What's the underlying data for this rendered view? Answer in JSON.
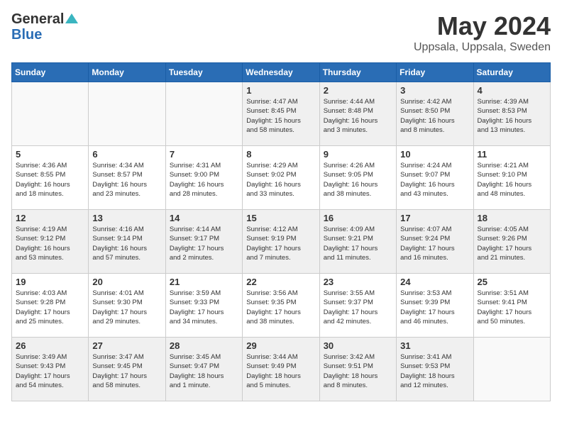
{
  "header": {
    "logo_general": "General",
    "logo_blue": "Blue",
    "month_title": "May 2024",
    "location": "Uppsala, Uppsala, Sweden"
  },
  "days_of_week": [
    "Sunday",
    "Monday",
    "Tuesday",
    "Wednesday",
    "Thursday",
    "Friday",
    "Saturday"
  ],
  "weeks": [
    [
      {
        "day": "",
        "info": ""
      },
      {
        "day": "",
        "info": ""
      },
      {
        "day": "",
        "info": ""
      },
      {
        "day": "1",
        "info": "Sunrise: 4:47 AM\nSunset: 8:45 PM\nDaylight: 15 hours\nand 58 minutes."
      },
      {
        "day": "2",
        "info": "Sunrise: 4:44 AM\nSunset: 8:48 PM\nDaylight: 16 hours\nand 3 minutes."
      },
      {
        "day": "3",
        "info": "Sunrise: 4:42 AM\nSunset: 8:50 PM\nDaylight: 16 hours\nand 8 minutes."
      },
      {
        "day": "4",
        "info": "Sunrise: 4:39 AM\nSunset: 8:53 PM\nDaylight: 16 hours\nand 13 minutes."
      }
    ],
    [
      {
        "day": "5",
        "info": "Sunrise: 4:36 AM\nSunset: 8:55 PM\nDaylight: 16 hours\nand 18 minutes."
      },
      {
        "day": "6",
        "info": "Sunrise: 4:34 AM\nSunset: 8:57 PM\nDaylight: 16 hours\nand 23 minutes."
      },
      {
        "day": "7",
        "info": "Sunrise: 4:31 AM\nSunset: 9:00 PM\nDaylight: 16 hours\nand 28 minutes."
      },
      {
        "day": "8",
        "info": "Sunrise: 4:29 AM\nSunset: 9:02 PM\nDaylight: 16 hours\nand 33 minutes."
      },
      {
        "day": "9",
        "info": "Sunrise: 4:26 AM\nSunset: 9:05 PM\nDaylight: 16 hours\nand 38 minutes."
      },
      {
        "day": "10",
        "info": "Sunrise: 4:24 AM\nSunset: 9:07 PM\nDaylight: 16 hours\nand 43 minutes."
      },
      {
        "day": "11",
        "info": "Sunrise: 4:21 AM\nSunset: 9:10 PM\nDaylight: 16 hours\nand 48 minutes."
      }
    ],
    [
      {
        "day": "12",
        "info": "Sunrise: 4:19 AM\nSunset: 9:12 PM\nDaylight: 16 hours\nand 53 minutes."
      },
      {
        "day": "13",
        "info": "Sunrise: 4:16 AM\nSunset: 9:14 PM\nDaylight: 16 hours\nand 57 minutes."
      },
      {
        "day": "14",
        "info": "Sunrise: 4:14 AM\nSunset: 9:17 PM\nDaylight: 17 hours\nand 2 minutes."
      },
      {
        "day": "15",
        "info": "Sunrise: 4:12 AM\nSunset: 9:19 PM\nDaylight: 17 hours\nand 7 minutes."
      },
      {
        "day": "16",
        "info": "Sunrise: 4:09 AM\nSunset: 9:21 PM\nDaylight: 17 hours\nand 11 minutes."
      },
      {
        "day": "17",
        "info": "Sunrise: 4:07 AM\nSunset: 9:24 PM\nDaylight: 17 hours\nand 16 minutes."
      },
      {
        "day": "18",
        "info": "Sunrise: 4:05 AM\nSunset: 9:26 PM\nDaylight: 17 hours\nand 21 minutes."
      }
    ],
    [
      {
        "day": "19",
        "info": "Sunrise: 4:03 AM\nSunset: 9:28 PM\nDaylight: 17 hours\nand 25 minutes."
      },
      {
        "day": "20",
        "info": "Sunrise: 4:01 AM\nSunset: 9:30 PM\nDaylight: 17 hours\nand 29 minutes."
      },
      {
        "day": "21",
        "info": "Sunrise: 3:59 AM\nSunset: 9:33 PM\nDaylight: 17 hours\nand 34 minutes."
      },
      {
        "day": "22",
        "info": "Sunrise: 3:56 AM\nSunset: 9:35 PM\nDaylight: 17 hours\nand 38 minutes."
      },
      {
        "day": "23",
        "info": "Sunrise: 3:55 AM\nSunset: 9:37 PM\nDaylight: 17 hours\nand 42 minutes."
      },
      {
        "day": "24",
        "info": "Sunrise: 3:53 AM\nSunset: 9:39 PM\nDaylight: 17 hours\nand 46 minutes."
      },
      {
        "day": "25",
        "info": "Sunrise: 3:51 AM\nSunset: 9:41 PM\nDaylight: 17 hours\nand 50 minutes."
      }
    ],
    [
      {
        "day": "26",
        "info": "Sunrise: 3:49 AM\nSunset: 9:43 PM\nDaylight: 17 hours\nand 54 minutes."
      },
      {
        "day": "27",
        "info": "Sunrise: 3:47 AM\nSunset: 9:45 PM\nDaylight: 17 hours\nand 58 minutes."
      },
      {
        "day": "28",
        "info": "Sunrise: 3:45 AM\nSunset: 9:47 PM\nDaylight: 18 hours\nand 1 minute."
      },
      {
        "day": "29",
        "info": "Sunrise: 3:44 AM\nSunset: 9:49 PM\nDaylight: 18 hours\nand 5 minutes."
      },
      {
        "day": "30",
        "info": "Sunrise: 3:42 AM\nSunset: 9:51 PM\nDaylight: 18 hours\nand 8 minutes."
      },
      {
        "day": "31",
        "info": "Sunrise: 3:41 AM\nSunset: 9:53 PM\nDaylight: 18 hours\nand 12 minutes."
      },
      {
        "day": "",
        "info": ""
      }
    ]
  ]
}
